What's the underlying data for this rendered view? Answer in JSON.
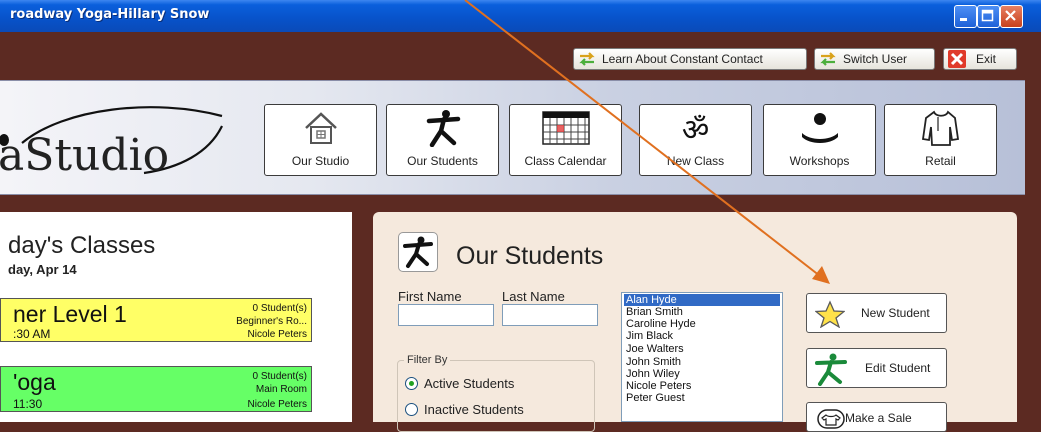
{
  "window": {
    "title": "roadway Yoga-Hillary Snow"
  },
  "top_actions": {
    "learn": "Learn About Constant Contact",
    "switch_user": "Switch User",
    "exit": "Exit"
  },
  "logo_text": "aStudio",
  "nav": [
    {
      "label": "Our Studio",
      "icon": "house-icon"
    },
    {
      "label": "Our Students",
      "icon": "yoga-pose-icon"
    },
    {
      "label": "Class Calendar",
      "icon": "calendar-icon"
    },
    {
      "label": "New Class",
      "icon": "om-icon"
    },
    {
      "label": "Workshops",
      "icon": "meditation-icon"
    },
    {
      "label": "Retail",
      "icon": "shirt-icon"
    }
  ],
  "today": {
    "title": "day's Classes",
    "date": "day, Apr 14",
    "classes": [
      {
        "name": "ner Level 1",
        "time": ":30 AM",
        "students": "0 Student(s)",
        "room": "Beginner's Ro...",
        "teacher": "Nicole Peters",
        "color": "#ffff66"
      },
      {
        "name": "'oga",
        "time": "11:30",
        "students": "0 Student(s)",
        "room": "Main Room",
        "teacher": "Nicole Peters",
        "color": "#66ff66"
      }
    ]
  },
  "students": {
    "title": "Our Students",
    "first_name_label": "First Name",
    "last_name_label": "Last Name",
    "first_name_value": "",
    "last_name_value": "",
    "filter_label": "Filter By",
    "filter_options": [
      "Active Students",
      "Inactive Students"
    ],
    "filter_selected": "Active Students",
    "list": [
      "Alan Hyde",
      "Brian Smith",
      "Caroline Hyde",
      "Jim Black",
      "Joe Walters",
      "John Smith",
      "John Wiley",
      "Nicole Peters",
      "Peter Guest"
    ],
    "selected": "Alan Hyde",
    "actions": {
      "new_student": "New Student",
      "edit_student": "Edit Student",
      "make_sale": "Make a Sale"
    }
  },
  "colors": {
    "maroon": "#5c2a22",
    "panel": "#f5e9dd",
    "arrow": "#e07020",
    "selection": "#316ac5"
  }
}
